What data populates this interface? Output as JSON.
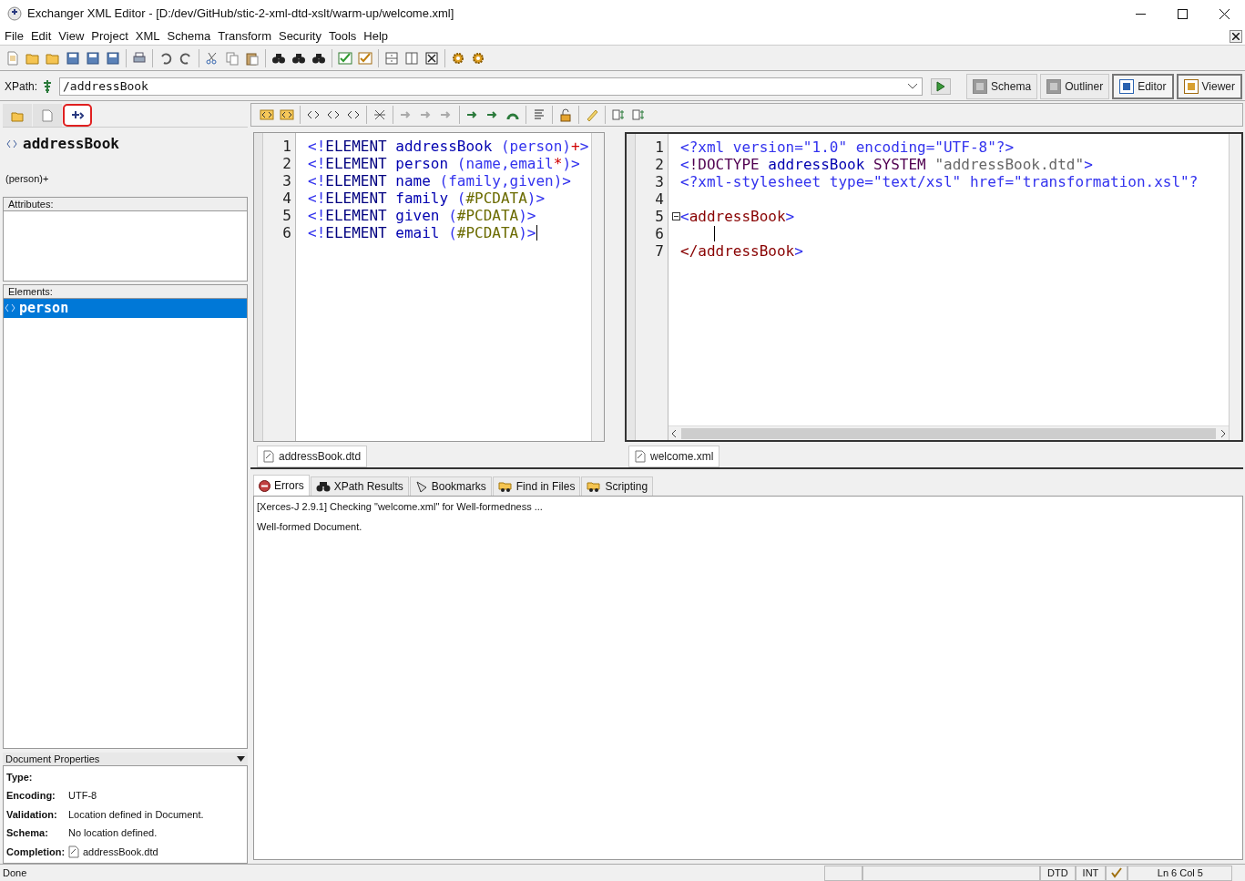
{
  "window": {
    "title": "Exchanger XML Editor - [D:/dev/GitHub/stic-2-xml-dtd-xslt/warm-up/welcome.xml]"
  },
  "menu": [
    "File",
    "Edit",
    "View",
    "Project",
    "XML",
    "Schema",
    "Transform",
    "Security",
    "Tools",
    "Help"
  ],
  "xpath": {
    "label": "XPath:",
    "value": "/addressBook"
  },
  "view_buttons": [
    {
      "label": "Schema",
      "selected": false,
      "disabled": true
    },
    {
      "label": "Outliner",
      "selected": false,
      "disabled": true
    },
    {
      "label": "Editor",
      "selected": true,
      "disabled": false
    },
    {
      "label": "Viewer",
      "selected": true,
      "disabled": false
    }
  ],
  "left_tabs": [
    {
      "selected": false,
      "highlighted": false
    },
    {
      "selected": false,
      "highlighted": false
    },
    {
      "selected": true,
      "highlighted": true
    }
  ],
  "element": {
    "name": "addressBook",
    "content_model": "(person)+"
  },
  "attributes": {
    "title": "Attributes:"
  },
  "elements": {
    "title": "Elements:",
    "items": [
      {
        "name": "person",
        "selected": true
      }
    ]
  },
  "document_properties": {
    "title": "Document Properties",
    "rows": [
      {
        "label": "Type:",
        "kind": "text"
      },
      {
        "label": "Encoding:",
        "value": "UTF-8",
        "kind": "text"
      },
      {
        "label": "Validation:",
        "value": "Location defined in Document.",
        "kind": "text"
      },
      {
        "label": "Schema:",
        "value": "No location defined.",
        "kind": "text"
      },
      {
        "label": "Completion:",
        "value": "addressBook.dtd",
        "kind": "file"
      }
    ]
  },
  "editors": [
    {
      "focused": false,
      "tab": "addressBook.dtd",
      "lines": [
        {
          "number": "1",
          "caret": false,
          "tokens": [
            {
              "text": "<!",
              "kind": "punct"
            },
            {
              "text": "ELEMENT ",
              "kind": "keyword"
            },
            {
              "text": "addressBook ",
              "kind": "name"
            },
            {
              "text": "(person)",
              "kind": "punct"
            },
            {
              "text": "+",
              "kind": "op"
            },
            {
              "text": ">",
              "kind": "punct"
            }
          ]
        },
        {
          "number": "2",
          "caret": false,
          "tokens": [
            {
              "text": "<!",
              "kind": "punct"
            },
            {
              "text": "ELEMENT ",
              "kind": "keyword"
            },
            {
              "text": "person ",
              "kind": "name"
            },
            {
              "text": "(name,email",
              "kind": "punct"
            },
            {
              "text": "*",
              "kind": "op"
            },
            {
              "text": ")>",
              "kind": "punct"
            }
          ]
        },
        {
          "number": "3",
          "caret": false,
          "tokens": [
            {
              "text": "<!",
              "kind": "punct"
            },
            {
              "text": "ELEMENT ",
              "kind": "keyword"
            },
            {
              "text": "name ",
              "kind": "name"
            },
            {
              "text": "(family,given)>",
              "kind": "punct"
            }
          ]
        },
        {
          "number": "4",
          "caret": false,
          "tokens": [
            {
              "text": "<!",
              "kind": "punct"
            },
            {
              "text": "ELEMENT ",
              "kind": "keyword"
            },
            {
              "text": "family ",
              "kind": "name"
            },
            {
              "text": "(",
              "kind": "punct"
            },
            {
              "text": "#PCDATA",
              "kind": "pcdata"
            },
            {
              "text": ")>",
              "kind": "punct"
            }
          ]
        },
        {
          "number": "5",
          "caret": false,
          "tokens": [
            {
              "text": "<!",
              "kind": "punct"
            },
            {
              "text": "ELEMENT ",
              "kind": "keyword"
            },
            {
              "text": "given ",
              "kind": "name"
            },
            {
              "text": "(",
              "kind": "punct"
            },
            {
              "text": "#PCDATA",
              "kind": "pcdata"
            },
            {
              "text": ")>",
              "kind": "punct"
            }
          ]
        },
        {
          "number": "6",
          "caret": true,
          "tokens": [
            {
              "text": "<!",
              "kind": "punct"
            },
            {
              "text": "ELEMENT ",
              "kind": "keyword"
            },
            {
              "text": "email ",
              "kind": "name"
            },
            {
              "text": "(",
              "kind": "punct"
            },
            {
              "text": "#PCDATA",
              "kind": "pcdata"
            },
            {
              "text": ")>",
              "kind": "punct"
            }
          ]
        }
      ]
    },
    {
      "focused": true,
      "tab": "welcome.xml",
      "lines": [
        {
          "number": "1",
          "caret": false,
          "tokens": [
            {
              "text": "<?xml version=\"1.0\" encoding=\"UTF-8\"?>",
              "kind": "punct"
            }
          ]
        },
        {
          "number": "2",
          "caret": false,
          "tokens": [
            {
              "text": "<",
              "kind": "punct"
            },
            {
              "text": "!DOCTYPE ",
              "kind": "doctype"
            },
            {
              "text": "addressBook ",
              "kind": "name"
            },
            {
              "text": "SYSTEM ",
              "kind": "doctype"
            },
            {
              "text": "\"addressBook.dtd\"",
              "kind": "string"
            },
            {
              "text": ">",
              "kind": "punct"
            }
          ]
        },
        {
          "number": "3",
          "caret": false,
          "tokens": [
            {
              "text": "<?xml-stylesheet type=\"text/xsl\" href=\"transformation.xsl\"?",
              "kind": "punct"
            }
          ]
        },
        {
          "number": "4",
          "caret": false
        },
        {
          "number": "5",
          "caret": false,
          "expanded": true,
          "tokens": [
            {
              "text": "<",
              "kind": "punct"
            },
            {
              "text": "addressBook",
              "kind": "tag"
            },
            {
              "text": ">",
              "kind": "punct"
            }
          ]
        },
        {
          "number": "6",
          "caret": true
        },
        {
          "number": "7",
          "caret": false,
          "tokens": [
            {
              "text": "</addressBook",
              "kind": "tag"
            },
            {
              "text": ">",
              "kind": "punct"
            }
          ]
        }
      ]
    }
  ],
  "output": {
    "tabs": [
      {
        "label": "Errors",
        "selected": true
      },
      {
        "label": "XPath Results",
        "selected": false
      },
      {
        "label": "Bookmarks",
        "selected": false
      },
      {
        "label": "Find in Files",
        "selected": false
      },
      {
        "label": "Scripting",
        "selected": false
      }
    ],
    "messages": [
      "[Xerces-J 2.9.1] Checking \"welcome.xml\" for Well-formedness ...",
      "Well-formed Document."
    ]
  },
  "status_bar": {
    "message": "Done",
    "cells": [
      {
        "kind": "blank"
      },
      {
        "kind": "blank"
      },
      {
        "kind": "text",
        "text": "DTD"
      },
      {
        "kind": "text",
        "text": "INT"
      },
      {
        "kind": "check"
      },
      {
        "kind": "text",
        "text": "Ln 6 Col 5"
      }
    ]
  }
}
